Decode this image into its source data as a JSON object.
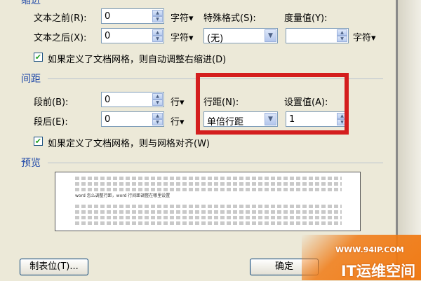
{
  "indent": {
    "title": "缩进",
    "before_text_label": "文本之前(R):",
    "before_text_value": "0",
    "before_text_unit": "字符▾",
    "after_text_label": "文本之后(X):",
    "after_text_value": "0",
    "after_text_unit": "字符▾",
    "special_label": "特殊格式(S):",
    "special_value": "(无)",
    "measure_label": "度量值(Y):",
    "measure_value": "",
    "measure_unit": "字符▾",
    "auto_right_indent_checkbox": "如果定义了文档网格，则自动调整右缩进(D)"
  },
  "spacing": {
    "title": "间距",
    "before_label": "段前(B):",
    "before_value": "0",
    "before_unit": "行▾",
    "after_label": "段后(E):",
    "after_value": "0",
    "after_unit": "行▾",
    "line_spacing_label": "行距(N):",
    "line_spacing_value": "单倍行距",
    "set_value_label": "设置值(A):",
    "set_value_value": "1",
    "snap_to_grid_checkbox": "如果定义了文档网格，则与网格对齐(W)"
  },
  "preview": {
    "title": "预览",
    "sample_text": "word 怎么调整行距，word 行间距调整在哪里设置"
  },
  "buttons": {
    "tabs": "制表位(T)...",
    "ok": "确定"
  },
  "watermark": {
    "url": "WWW.94IP.COM",
    "brand": "IT运维空间"
  },
  "colors": {
    "dialog_bg": "#ece9d8",
    "section_title": "#2049a8",
    "highlight": "#d41e1e",
    "watermark_orange": "#f07a14"
  }
}
